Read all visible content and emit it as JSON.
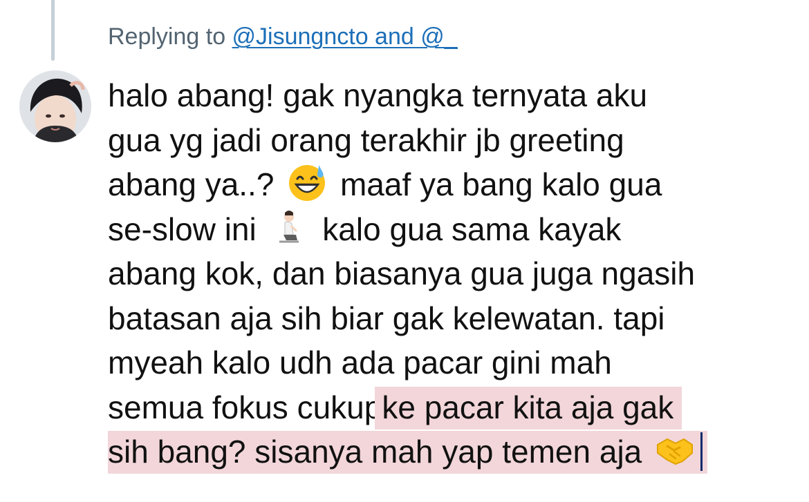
{
  "reply": {
    "prefix": "Replying to ",
    "mentions": "@Jisungncto and @_"
  },
  "tweet": {
    "lines": [
      "halo abang! gak nyangka ternyata aku",
      "gua yg jadi orang terakhir jb greeting",
      "abang ya..?",
      "maaf ya bang kalo gua",
      "se-slow ini",
      "kalo gua sama kayak",
      "abang kok, dan biasanya gua juga ngasih",
      "batasan aja sih biar gak kelewatan. tapi",
      "myeah kalo udh ada pacar gini mah",
      "semua fokus cukup",
      "ke pacar kita aja gak",
      "sih bang? sisanya mah yap temen aja"
    ],
    "emojis": [
      "grinning-sweat-emoji",
      "person-kneeling-emoji",
      "handshake-emoji"
    ],
    "highlight_color": "#f2d6da"
  },
  "colors": {
    "thread_line": "#c4cfd6",
    "reply_text": "#536471",
    "mention": "#1d6fb8",
    "cursor": "#0c2a6b"
  }
}
